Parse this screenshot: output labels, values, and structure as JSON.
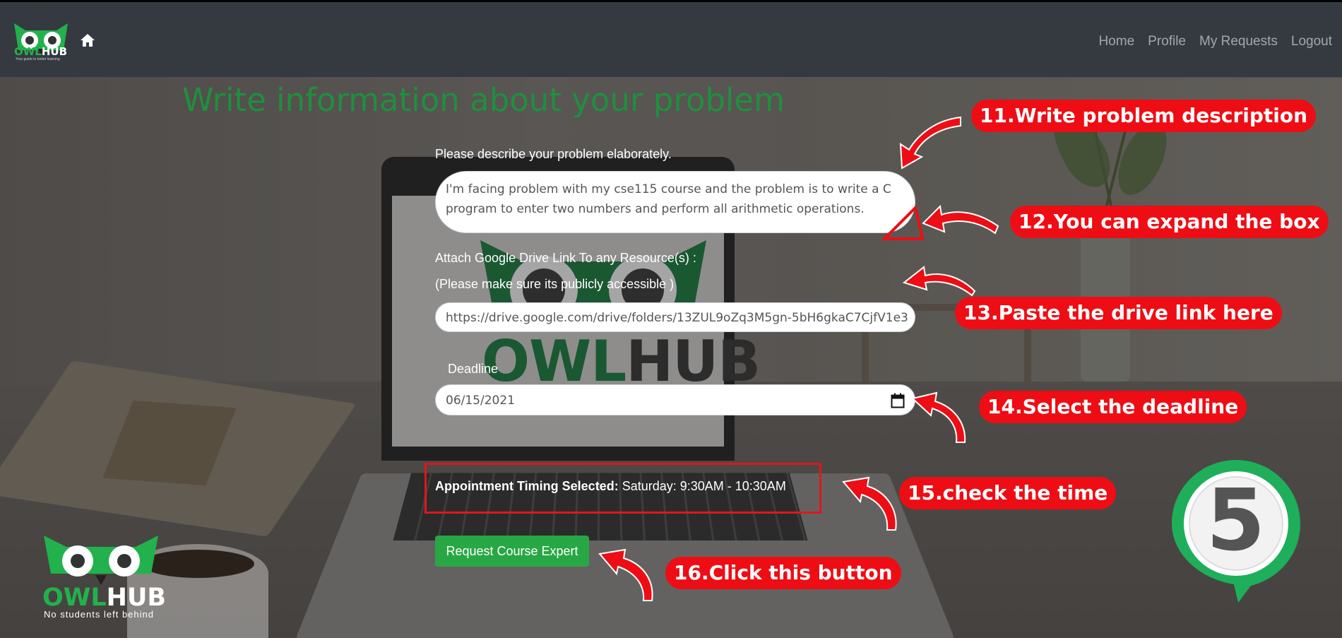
{
  "navbar": {
    "brand_owl": "OWL",
    "brand_hub": "HUB",
    "brand_tagline": "Your guide to better learning",
    "links": [
      "Home",
      "Profile",
      "My Requests",
      "Logout"
    ]
  },
  "page": {
    "title": "Write information about your problem"
  },
  "form": {
    "description_label": "Please describe your problem elaborately.",
    "description_value": "I'm facing problem with my cse115 course and the problem is to write a C program to enter two numbers and perform all arithmetic operations.",
    "drive_label": "Attach Google Drive Link To any Resource(s) :",
    "drive_note": "(Please make sure its publicly accessible )",
    "drive_value": "https://drive.google.com/drive/folders/13ZUL9oZq3M5gn-5bH6gkaC7CjfV1e3",
    "deadline_label": "Deadline",
    "deadline_value": "06/15/2021",
    "appointment_label": "Appointment Timing Selected:",
    "appointment_value": " Saturday: 9:30AM - 10:30AM",
    "submit_label": "Request Course Expert"
  },
  "callouts": {
    "c11": "11.Write problem description",
    "c12": "12.You can expand the box",
    "c13": "13.Paste the drive link here",
    "c14": "14.Select the deadline",
    "c15": "15.check the time",
    "c16": "16.Click this button"
  },
  "bottom_logo": {
    "owl": "OWL",
    "hub": "HUB",
    "tagline": "No students left behind"
  },
  "step_badge": "5",
  "colors": {
    "navbar": "#343a40",
    "title_green": "#1f8f3e",
    "callout_red": "#ee0d14",
    "button_green": "#28a745",
    "brand_green": "#22b14c"
  }
}
